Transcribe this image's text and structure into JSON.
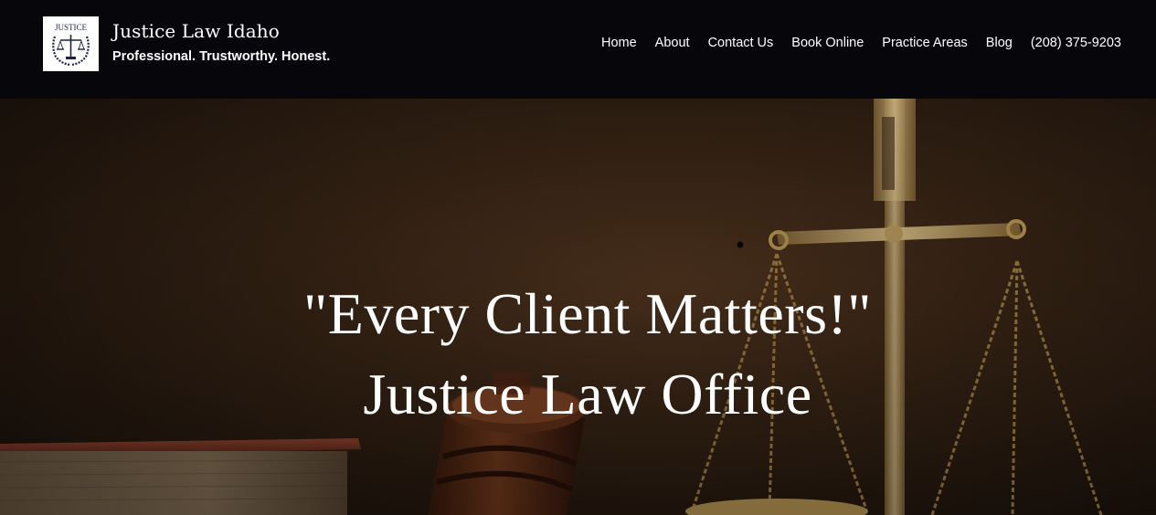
{
  "header": {
    "logo_text": "JUSTICE",
    "brand_name": "Justice Law Idaho",
    "tagline": "Professional. Trustworthy. Honest."
  },
  "nav": {
    "items": [
      {
        "label": "Home"
      },
      {
        "label": "About"
      },
      {
        "label": "Contact Us"
      },
      {
        "label": "Book Online"
      },
      {
        "label": "Practice Areas"
      },
      {
        "label": "Blog"
      },
      {
        "label": "(208) 375-9203"
      }
    ]
  },
  "hero": {
    "headline": "\"Every Client Matters!\"",
    "subheadline": "Justice Law Office"
  },
  "colors": {
    "header_bg": "#07070b",
    "text": "#ffffff",
    "hero_dark": "#24170f",
    "brass": "#c9a45c"
  }
}
